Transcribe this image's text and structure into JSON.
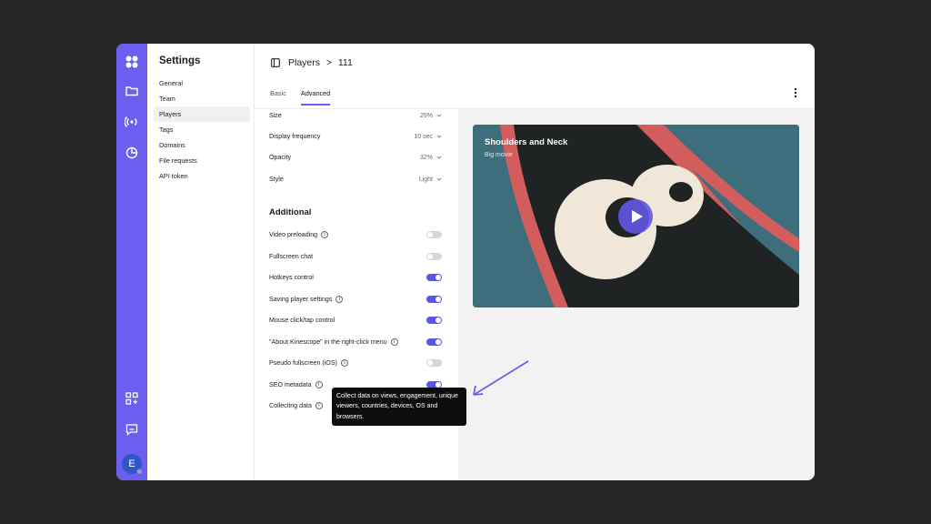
{
  "settings_nav": {
    "title": "Settings",
    "items": [
      "General",
      "Team",
      "Players",
      "Tags",
      "Domains",
      "File requests",
      "API token"
    ],
    "active_index": 2
  },
  "header": {
    "breadcrumb_parent": "Players",
    "breadcrumb_separator": ">",
    "breadcrumb_current": "111",
    "tabs": [
      "Basic",
      "Advanced"
    ],
    "active_tab": "Advanced"
  },
  "player_settings": {
    "size": {
      "label": "Size",
      "value": "25%"
    },
    "display_frequency": {
      "label": "Display frequency",
      "value": "10 sec"
    },
    "opacity": {
      "label": "Opacity",
      "value": "32%"
    },
    "style": {
      "label": "Style",
      "value": "Light"
    }
  },
  "additional": {
    "title": "Additional",
    "items": [
      {
        "label": "Video preloading",
        "info": true,
        "on": false
      },
      {
        "label": "Fullscreen chat",
        "info": false,
        "on": false
      },
      {
        "label": "Hotkeys control",
        "info": false,
        "on": true
      },
      {
        "label": "Saving player settings",
        "info": true,
        "on": true
      },
      {
        "label": "Mouse click/tap control",
        "info": false,
        "on": true
      },
      {
        "label": "\"About Kinescope\" in the right-click menu",
        "info": true,
        "on": true
      },
      {
        "label": "Pseudo fullscreen (iOS)",
        "info": true,
        "on": false
      },
      {
        "label": "SEO metadata",
        "info": true,
        "on": true
      },
      {
        "label": "Collecting data",
        "info": true,
        "on": false
      }
    ]
  },
  "video": {
    "title": "Shoulders and Neck",
    "subtitle": "Big movie"
  },
  "tooltip": {
    "text": "Collect data on views, engagement, unique viewers, countries, devices, OS and browsers."
  },
  "user": {
    "avatar_letter": "E"
  },
  "colors": {
    "accent": "#6b5ff0",
    "toggle_on": "#5b55e6",
    "background": "#262626"
  }
}
